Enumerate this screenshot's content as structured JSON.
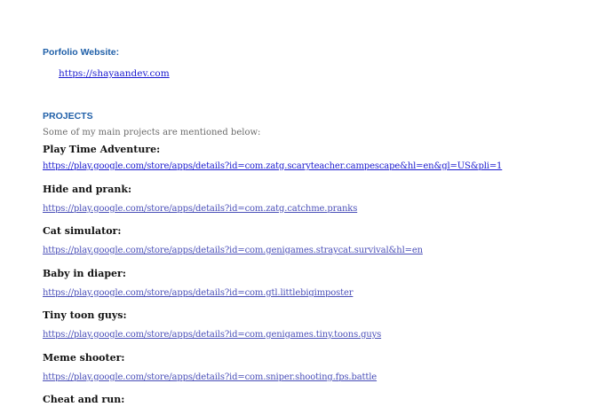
{
  "portfolio": {
    "heading": "Porfolio Website:",
    "link": "https://shayaandev.com"
  },
  "projects": {
    "heading": "PROJECTS",
    "intro": "Some of my main projects are mentioned below:",
    "items": [
      {
        "title": "Play Time Adventure:",
        "link": "https://play.google.com/store/apps/details?id=com.zatg.scaryteacher.campescape&hl=en&gl=US&pli=1"
      },
      {
        "title": "Hide and prank:",
        "link": "https://play.google.com/store/apps/details?id=com.zatg.catchme.pranks"
      },
      {
        "title": "Cat simulator:",
        "link": "https://play.google.com/store/apps/details?id=com.genigames.straycat.survival&hl=en"
      },
      {
        "title": "Baby in diaper:",
        "link": "https://play.google.com/store/apps/details?id=com.gtl.littlebigimposter"
      },
      {
        "title": "Tiny toon guys:",
        "link": "https://play.google.com/store/apps/details?id=com.genigames.tiny.toons.guys"
      },
      {
        "title": "Meme shooter:",
        "link": "https://play.google.com/store/apps/details?id=com.sniper.shooting.fps.battle"
      },
      {
        "title": "Cheat and run:"
      }
    ]
  }
}
